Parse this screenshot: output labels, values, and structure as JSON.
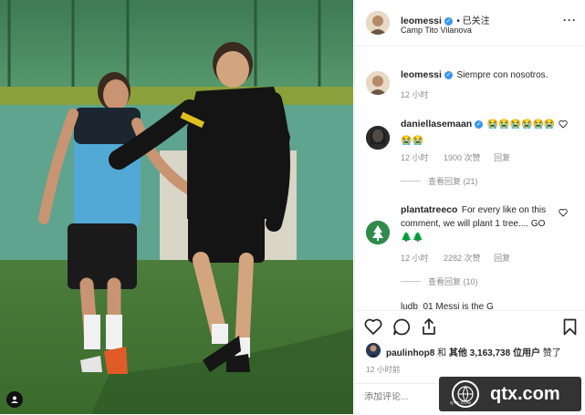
{
  "post": {
    "author": "leomessi",
    "location": "Camp Tito Vilanova",
    "follow_status": "• 已关注",
    "more": "···"
  },
  "caption": {
    "author": "leomessi",
    "text": "Siempre con nosotros.",
    "time": "12 小时"
  },
  "comments": [
    {
      "author": "daniellasemaan",
      "text": "😭😭😭😭😭😭😭😭",
      "time": "12 小时",
      "likes": "1900 次赞",
      "reply": "回复",
      "view_replies": "查看回复 (21)"
    },
    {
      "author": "plantatreeco",
      "text": "For every like on this comment, we will plant 1 tree.... GO🌲🌲",
      "time": "12 小时",
      "likes": "2282 次赞",
      "reply": "回复",
      "view_replies": "查看回复 (10)"
    }
  ],
  "partial_comment": "ludb_01 Messi is the G",
  "likes_line": {
    "user": "paulinhop8",
    "mid": " 和 ",
    "others": "其他 3,163,738 位用户",
    "end": " 赞了"
  },
  "post_time": "12 小时前",
  "add_comment_placeholder": "添加评论...",
  "watermark": {
    "site": "qtx.com",
    "logo_text": "QTX.COM"
  },
  "colors": {
    "verified": "#3897f0",
    "grass": "#3e6b34",
    "fence": "#3a7a4e"
  }
}
